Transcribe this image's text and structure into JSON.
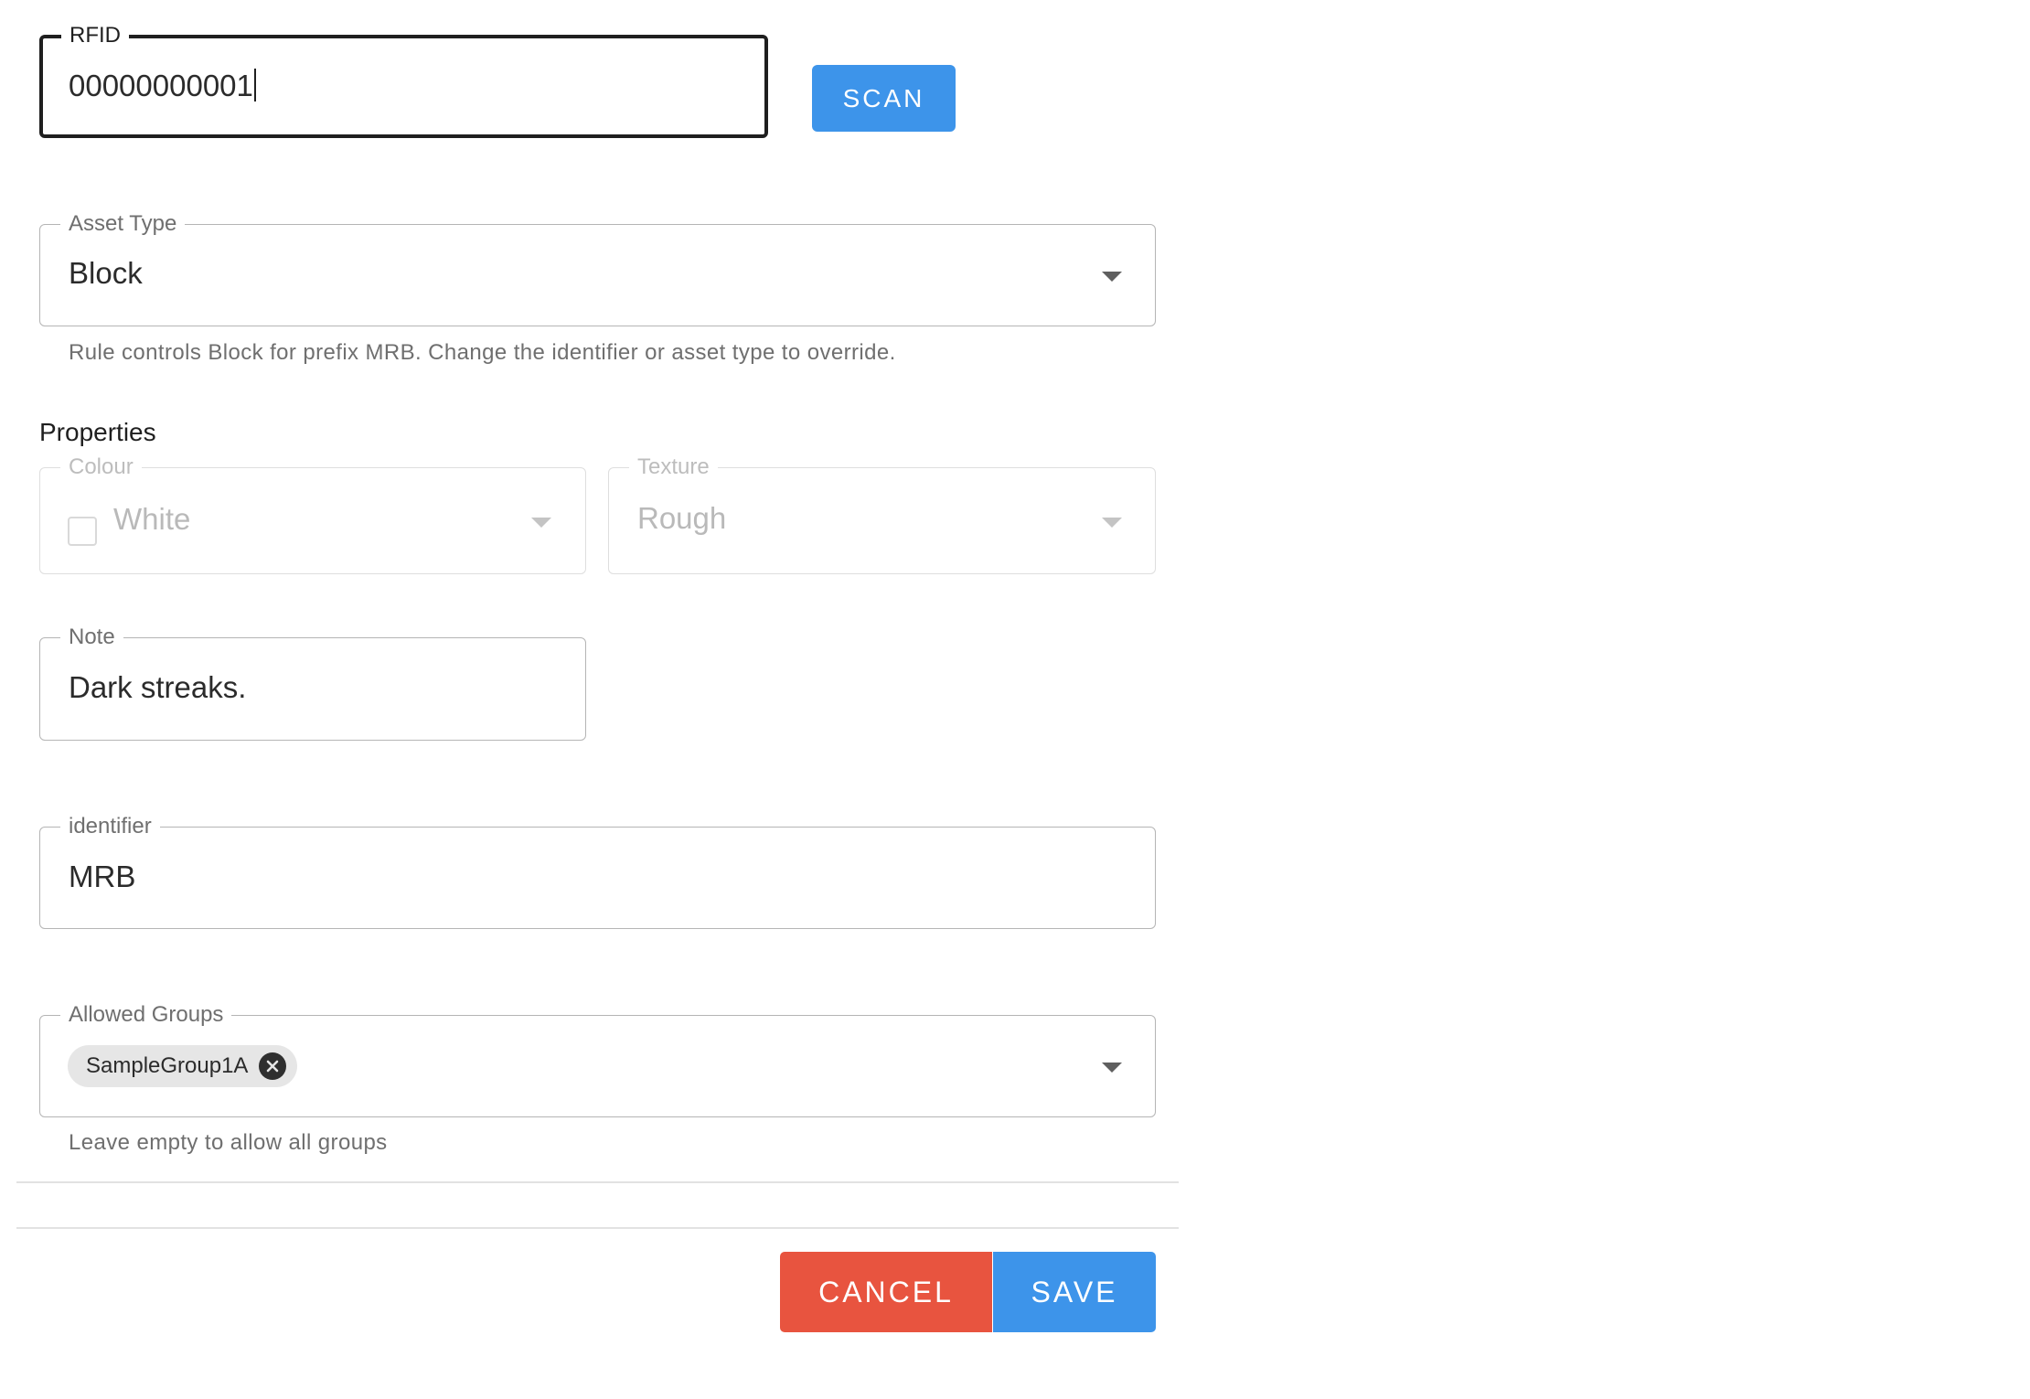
{
  "rfid": {
    "label": "RFID",
    "value": "00000000001",
    "scan_label": "SCAN"
  },
  "asset_type": {
    "label": "Asset Type",
    "value": "Block",
    "helper": "Rule controls Block for prefix MRB. Change the identifier or asset type to override."
  },
  "properties": {
    "title": "Properties",
    "colour": {
      "label": "Colour",
      "value": "White"
    },
    "texture": {
      "label": "Texture",
      "value": "Rough"
    }
  },
  "note": {
    "label": "Note",
    "value": "Dark streaks."
  },
  "identifier": {
    "label": "identifier",
    "value": "MRB"
  },
  "allowed_groups": {
    "label": "Allowed Groups",
    "chips": [
      "SampleGroup1A"
    ],
    "helper": "Leave empty to allow all groups"
  },
  "actions": {
    "cancel_label": "CANCEL",
    "save_label": "SAVE"
  },
  "colors": {
    "primary": "#3d94ea",
    "danger": "#e8543f"
  },
  "icons": {
    "dropdown": "chevron-down-icon",
    "chip_remove": "close-circle-icon"
  }
}
